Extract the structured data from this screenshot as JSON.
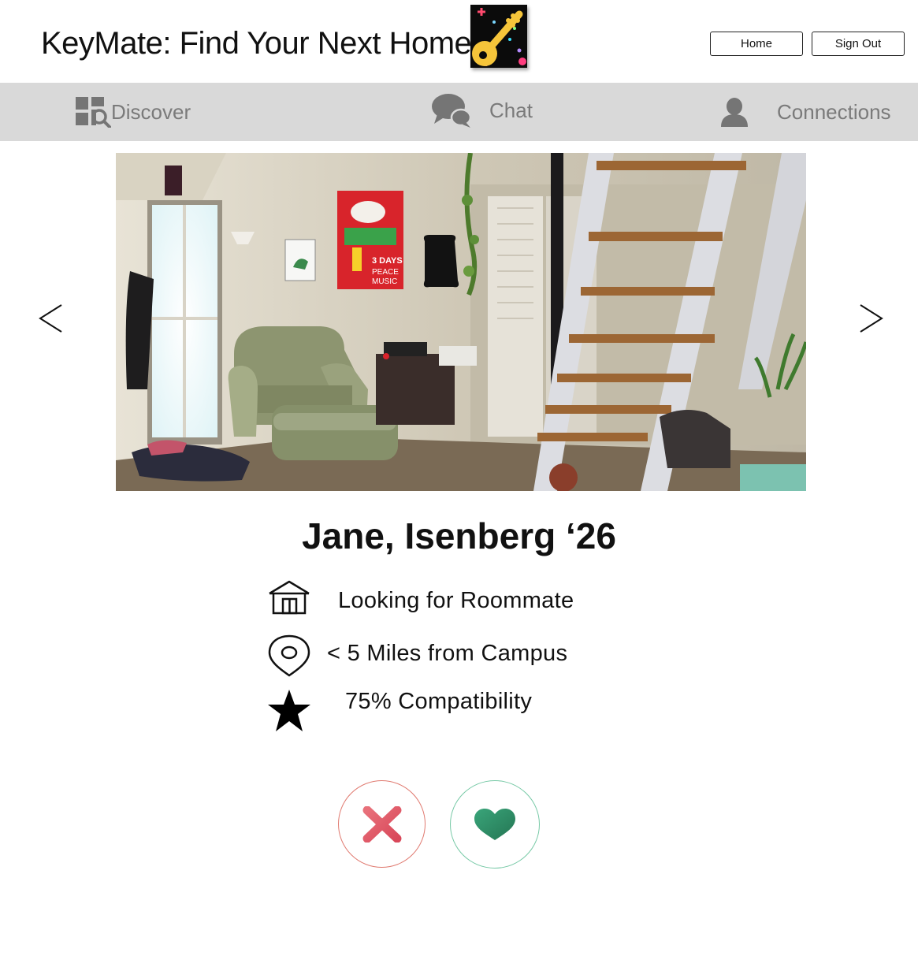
{
  "header": {
    "title": "KeyMate: Find Your Next Home",
    "home_label": "Home",
    "signout_label": "Sign Out"
  },
  "nav": {
    "items": [
      {
        "label": "Discover",
        "icon": "discover-icon"
      },
      {
        "label": "Chat",
        "icon": "chat-icon"
      },
      {
        "label": "Connections",
        "icon": "person-icon"
      }
    ]
  },
  "profile": {
    "name": "Jane, Isenberg ‘26",
    "status": "Looking for Roommate",
    "distance": "< 5 Miles from Campus",
    "compatibility": "75% Compatibility"
  },
  "actions": {
    "reject_icon": "close-icon",
    "like_icon": "heart-icon"
  },
  "colors": {
    "nav_background": "#d9d9d9",
    "reject": "#e0606b",
    "like": "#2e8b64"
  }
}
